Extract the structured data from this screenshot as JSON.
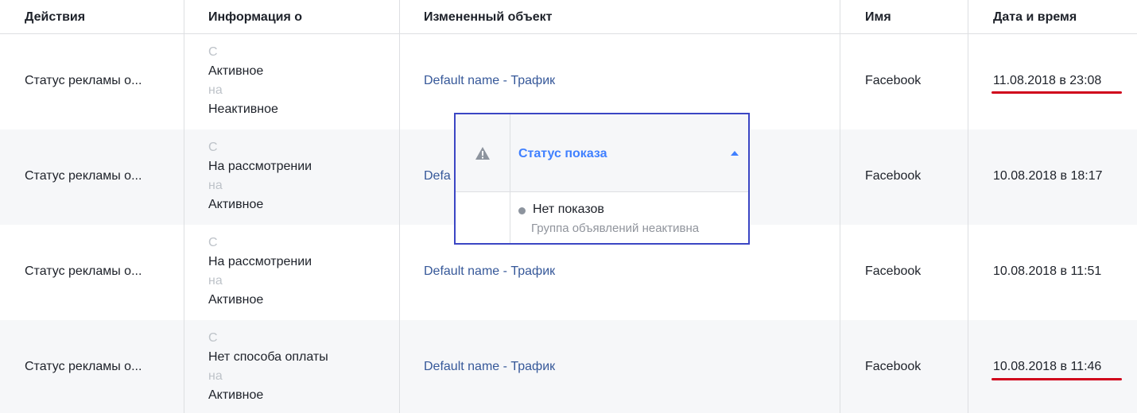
{
  "columns": {
    "actions": "Действия",
    "info": "Информация о",
    "object": "Измененный объект",
    "name": "Имя",
    "datetime": "Дата и время"
  },
  "from_label": "С",
  "to_label": "на",
  "rows": [
    {
      "action": "Статус рекламы о...",
      "from": "Активное",
      "to": "Неактивное",
      "object": "Default name - Трафик",
      "name": "Facebook",
      "datetime": "11.08.2018 в 23:08"
    },
    {
      "action": "Статус рекламы о...",
      "from": "На рассмотрении",
      "to": "Активное",
      "object": "Default name - Трафик",
      "name": "Facebook",
      "datetime": "10.08.2018 в 18:17"
    },
    {
      "action": "Статус рекламы о...",
      "from": "На рассмотрении",
      "to": "Активное",
      "object": "Default name - Трафик",
      "name": "Facebook",
      "datetime": "10.08.2018 в 11:51"
    },
    {
      "action": "Статус рекламы о...",
      "from": "Нет способа оплаты",
      "to": "Активное",
      "object": "Default name - Трафик",
      "name": "Facebook",
      "datetime": "10.08.2018 в 11:46"
    }
  ],
  "obscured_object_prefix": "Defa",
  "popover": {
    "icon": "warning-icon",
    "title": "Статус показа",
    "status": "Нет показов",
    "sub": "Группа объявлений неактивна"
  },
  "colors": {
    "link": "#365899",
    "accent": "#4080ff",
    "highlight_border": "#3b46c4",
    "annotation_underline": "#d0021b"
  }
}
